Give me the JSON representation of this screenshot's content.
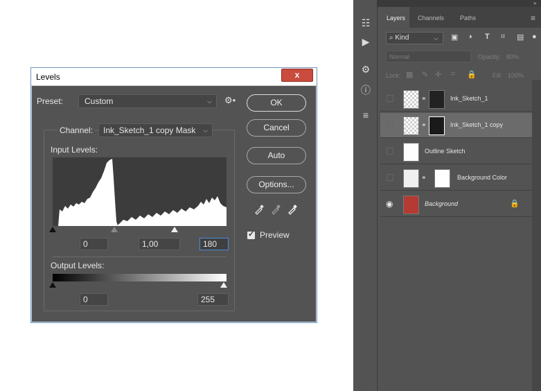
{
  "levels_dialog": {
    "title": "Levels",
    "close_glyph": "x",
    "preset_label": "Preset:",
    "preset_value": "Custom",
    "channel_label": "Channel:",
    "channel_value": "Ink_Sketch_1 copy Mask",
    "input_levels_label": "Input Levels:",
    "input_black": "0",
    "input_gamma": "1,00",
    "input_white": "180",
    "output_levels_label": "Output Levels:",
    "output_black": "0",
    "output_white": "255",
    "buttons": {
      "ok": "OK",
      "cancel": "Cancel",
      "auto": "Auto",
      "options": "Options..."
    },
    "preview_label": "Preview",
    "preview_checked": true
  },
  "layers_panel": {
    "tabs": [
      "Layers",
      "Channels",
      "Paths"
    ],
    "active_tab": "Layers",
    "kind_label": "Kind",
    "blend_mode": "Normal",
    "opacity_label": "Opacity:",
    "opacity_value": "80%",
    "lock_label": "Lock:",
    "fill_label": "Fill:",
    "fill_value": "100%",
    "layers": [
      {
        "name": "Ink_Sketch_1",
        "selected": false,
        "visible": false
      },
      {
        "name": "Ink_Sketch_1 copy",
        "selected": true,
        "visible": false
      },
      {
        "name": "Outline Sketch",
        "selected": false,
        "visible": false
      },
      {
        "name": "Background Color",
        "selected": false,
        "visible": false
      },
      {
        "name": "Background",
        "selected": false,
        "visible": true,
        "locked": true
      }
    ]
  },
  "colors": {
    "dialog_bg": "#535353",
    "panel_bg": "#535353",
    "accent": "#4a8fd8",
    "close_red": "#c94c3e"
  }
}
